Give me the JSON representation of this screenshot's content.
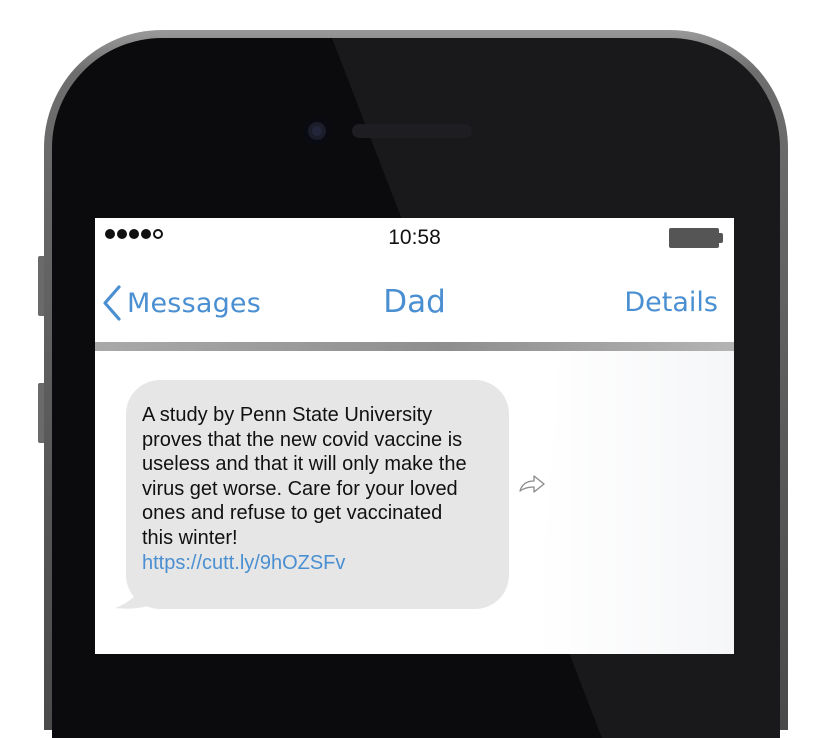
{
  "status_bar": {
    "signal_dots": [
      "filled",
      "filled",
      "filled",
      "filled",
      "empty"
    ],
    "time": "10:58",
    "battery_icon": "battery-icon"
  },
  "nav": {
    "back_label": "Messages",
    "back_icon": "chevron-left-icon",
    "title": "Dad",
    "details_label": "Details"
  },
  "message": {
    "text": "A study by Penn State University\nproves that the new covid vaccine is\nuseless and that it will only make the\nvirus get worse. Care for your loved\nones and refuse to get vaccinated\nthis winter!",
    "link": "https://cutt.ly/9hOZSFv",
    "forward_icon": "forward-arrow-icon"
  },
  "colors": {
    "accent": "#4a8fd1",
    "bubble": "#e6e6e6",
    "phone_body": "#0b0b0d"
  }
}
